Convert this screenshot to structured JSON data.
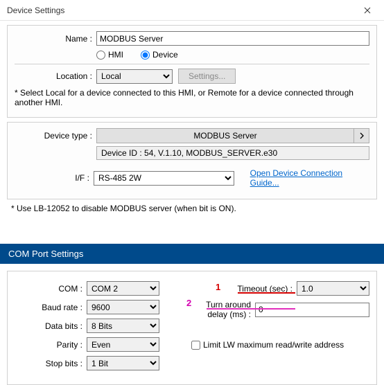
{
  "window": {
    "title": "Device Settings"
  },
  "nameRow": {
    "label": "Name :",
    "value": "MODBUS Server"
  },
  "typeRadio": {
    "hmi": "HMI",
    "device": "Device",
    "selected": "device"
  },
  "locationRow": {
    "label": "Location :",
    "value": "Local",
    "settingsBtn": "Settings..."
  },
  "locationNote": "* Select Local for a device connected to this HMI, or Remote for a device connected through another HMI.",
  "deviceType": {
    "label": "Device type :",
    "value": "MODBUS Server"
  },
  "deviceId": "Device ID : 54, V.1.10, MODBUS_SERVER.e30",
  "ifRow": {
    "label": "I/F :",
    "value": "RS-485 2W"
  },
  "guideLink": "Open Device Connection Guide...",
  "lbNote": "* Use LB-12052 to disable MODBUS server (when bit is ON).",
  "comHeader": "COM Port Settings",
  "com": {
    "comLabel": "COM :",
    "comValue": "COM 2",
    "baudLabel": "Baud rate :",
    "baudValue": "9600",
    "dataLabel": "Data bits :",
    "dataValue": "8 Bits",
    "parityLabel": "Parity :",
    "parityValue": "Even",
    "stopLabel": "Stop bits :",
    "stopValue": "1 Bit"
  },
  "right": {
    "timeoutLabel": "Timeout (sec) :",
    "timeoutValue": "1.0",
    "turnLabel": "Turn around delay (ms) :",
    "turnValue": "0",
    "limitLabel": "Limit LW maximum read/write address"
  },
  "annot": {
    "one": "1",
    "two": "2"
  }
}
